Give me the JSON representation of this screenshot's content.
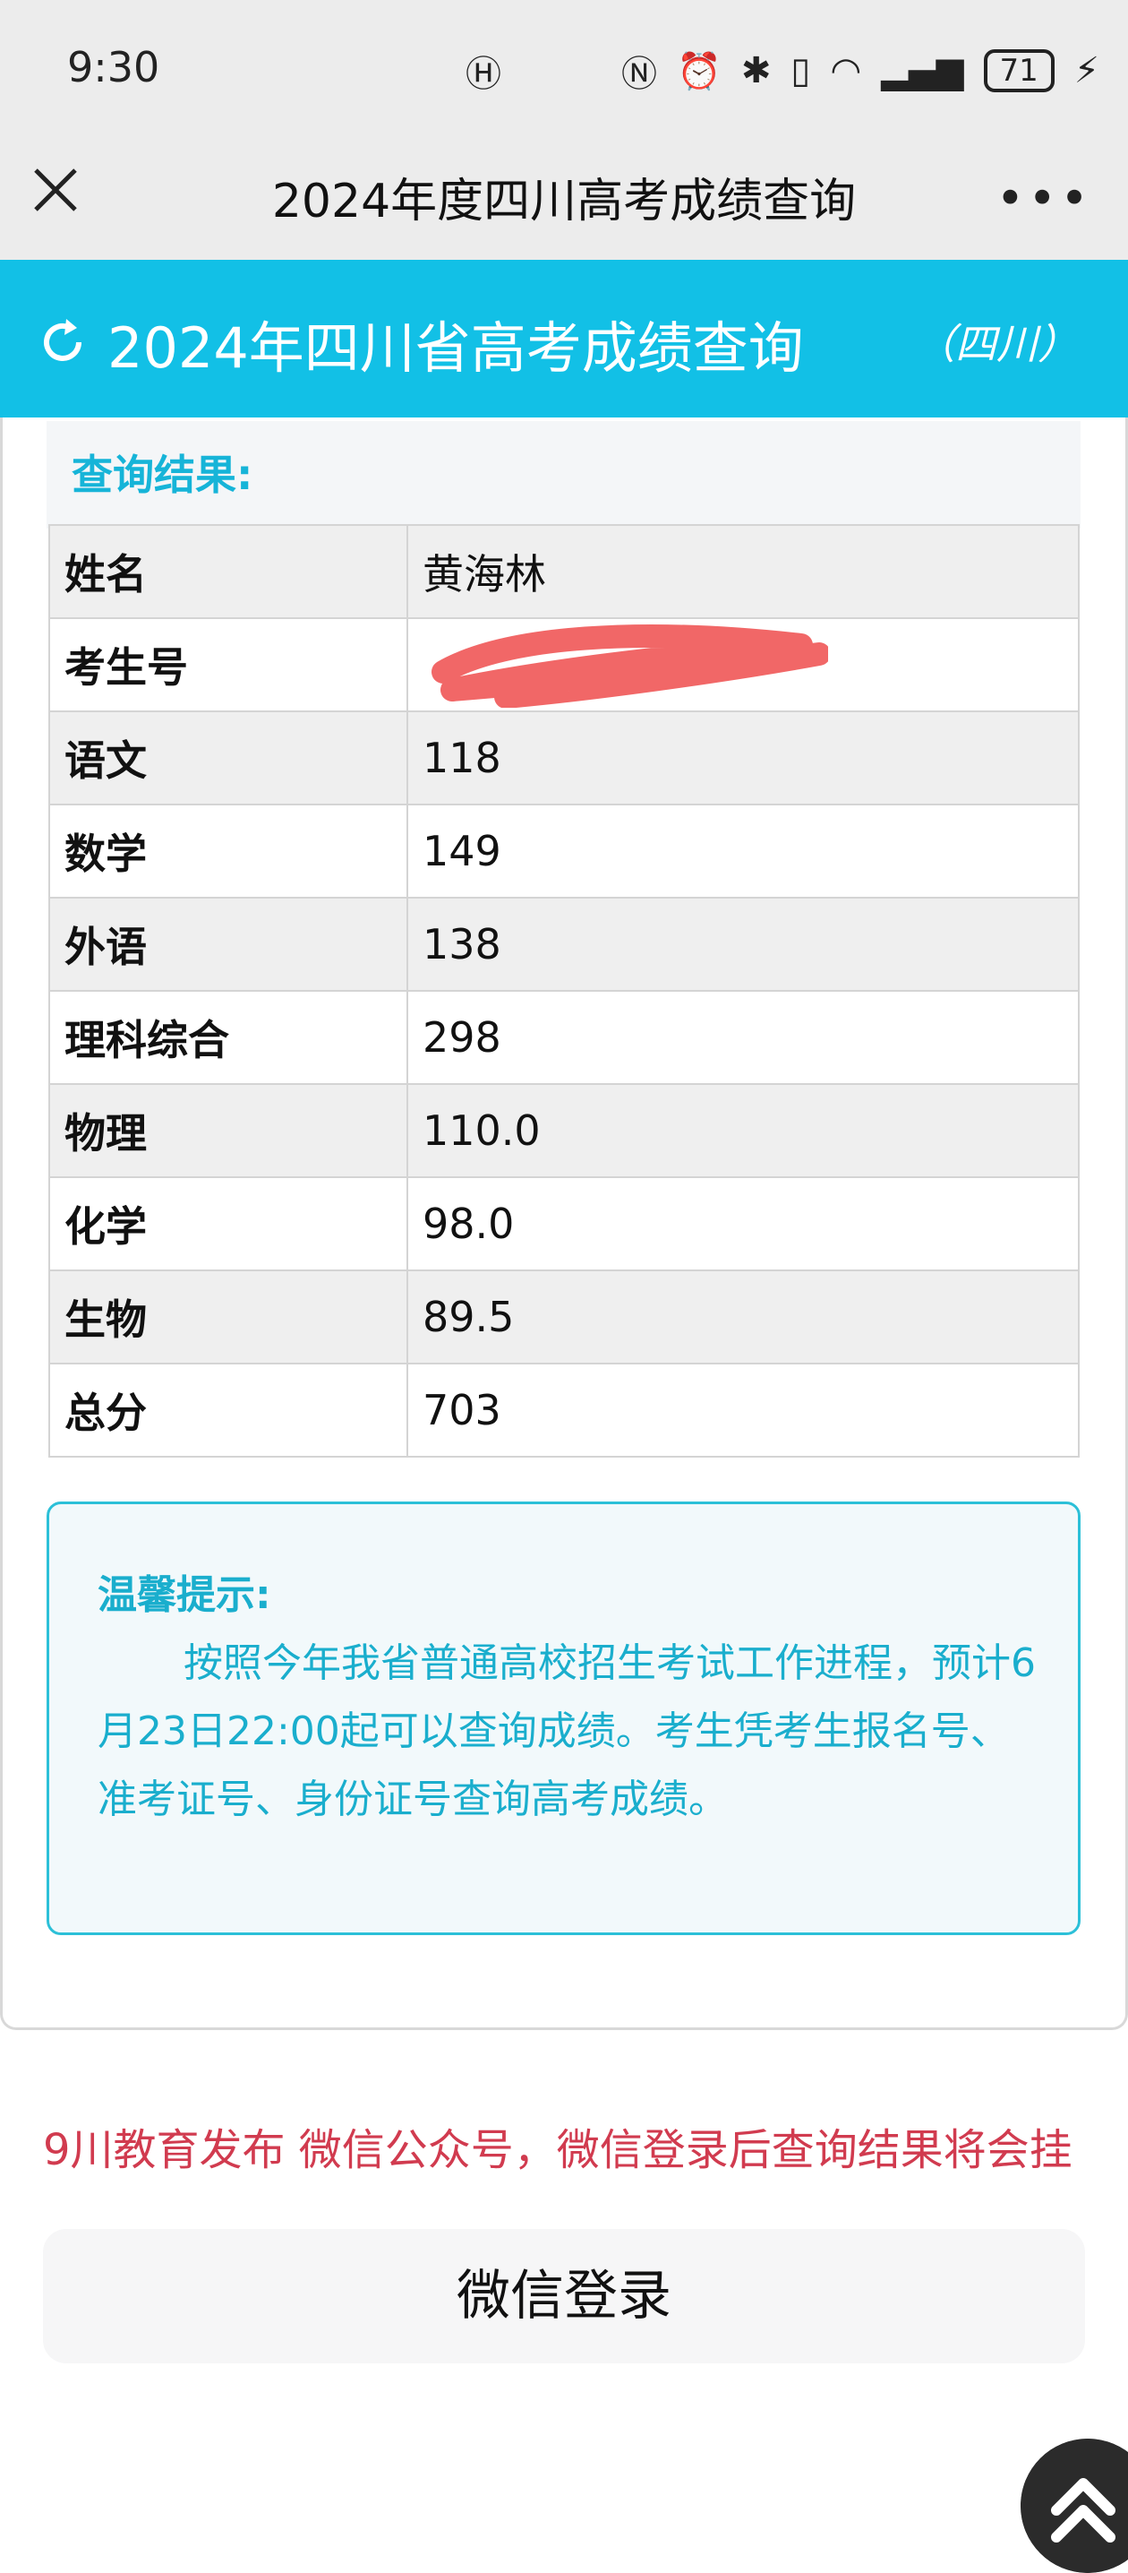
{
  "status_bar": {
    "time": "9:30",
    "battery": "71"
  },
  "nav": {
    "title": "2024年度四川高考成绩查询",
    "more": "•••"
  },
  "banner": {
    "title": "2024年四川省高考成绩查询",
    "region": "（四川）",
    "background": "#12c0e6"
  },
  "results": {
    "heading": "查询结果:",
    "rows": [
      {
        "label": "姓名",
        "value": "黄海林"
      },
      {
        "label": "考生号",
        "value": ""
      },
      {
        "label": "语文",
        "value": "118"
      },
      {
        "label": "数学",
        "value": "149"
      },
      {
        "label": "外语",
        "value": "138"
      },
      {
        "label": "理科综合",
        "value": "298"
      },
      {
        "label": "物理",
        "value": "110.0"
      },
      {
        "label": "化学",
        "value": "98.0"
      },
      {
        "label": "生物",
        "value": "89.5"
      },
      {
        "label": "总分",
        "value": "703"
      }
    ]
  },
  "tip": {
    "title": "温馨提示:",
    "body": "按照今年我省普通高校招生考试工作进程，预计6月23日22:00起可以查询成绩。考生凭考生报名号、准考证号、身份证号查询高考成绩。"
  },
  "ticker": {
    "text": "9川教育发布 微信公众号，微信登录后查询结果将会挂"
  },
  "login": {
    "label": "微信登录"
  }
}
